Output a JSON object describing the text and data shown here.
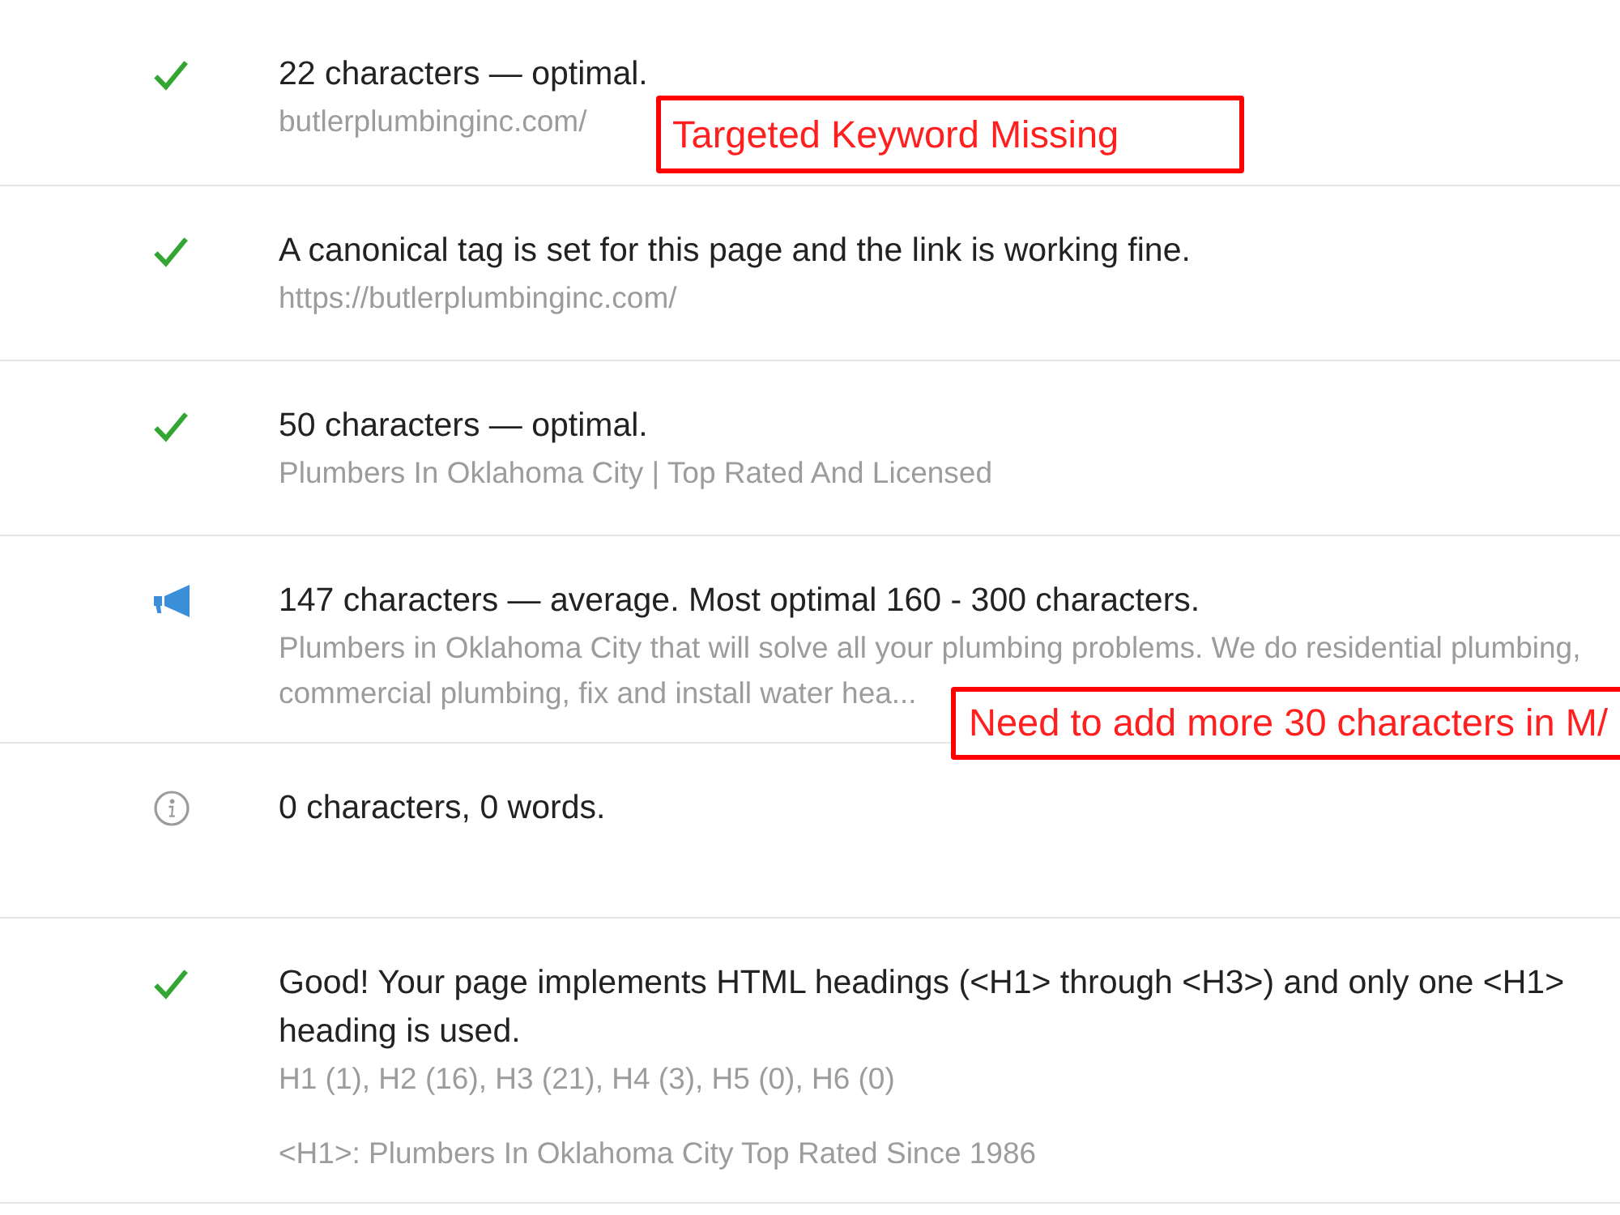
{
  "rows": [
    {
      "kind": "pass",
      "message": "22 characters — optimal.",
      "details": [
        "butlerplumbinginc.com/"
      ],
      "annotation": "Targeted Keyword Missing"
    },
    {
      "kind": "pass",
      "message": "A canonical tag is set for this page and the link is working fine.",
      "details": [
        "https://butlerplumbinginc.com/"
      ]
    },
    {
      "kind": "pass",
      "message": "50 characters — optimal.",
      "details": [
        "Plumbers In Oklahoma City | Top Rated And Licensed"
      ]
    },
    {
      "kind": "notice",
      "message": "147 characters — average. Most optimal 160 - 300 characters.",
      "details": [
        "Plumbers in Oklahoma City that will solve all your plumbing problems. We do residential plumbing, commercial plumbing, fix and install water hea..."
      ],
      "annotation": "Need to add more 30 characters in M/"
    },
    {
      "kind": "info",
      "message": "0 characters, 0 words."
    },
    {
      "kind": "pass",
      "message": "Good! Your page implements HTML headings (<H1> through <H3>) and only one <H1> heading is used.",
      "details": [
        "H1 (1), H2 (16), H3 (21), H4 (3), H5 (0), H6 (0)",
        "<H1>: Plumbers In Oklahoma City Top Rated Since 1986"
      ]
    }
  ]
}
